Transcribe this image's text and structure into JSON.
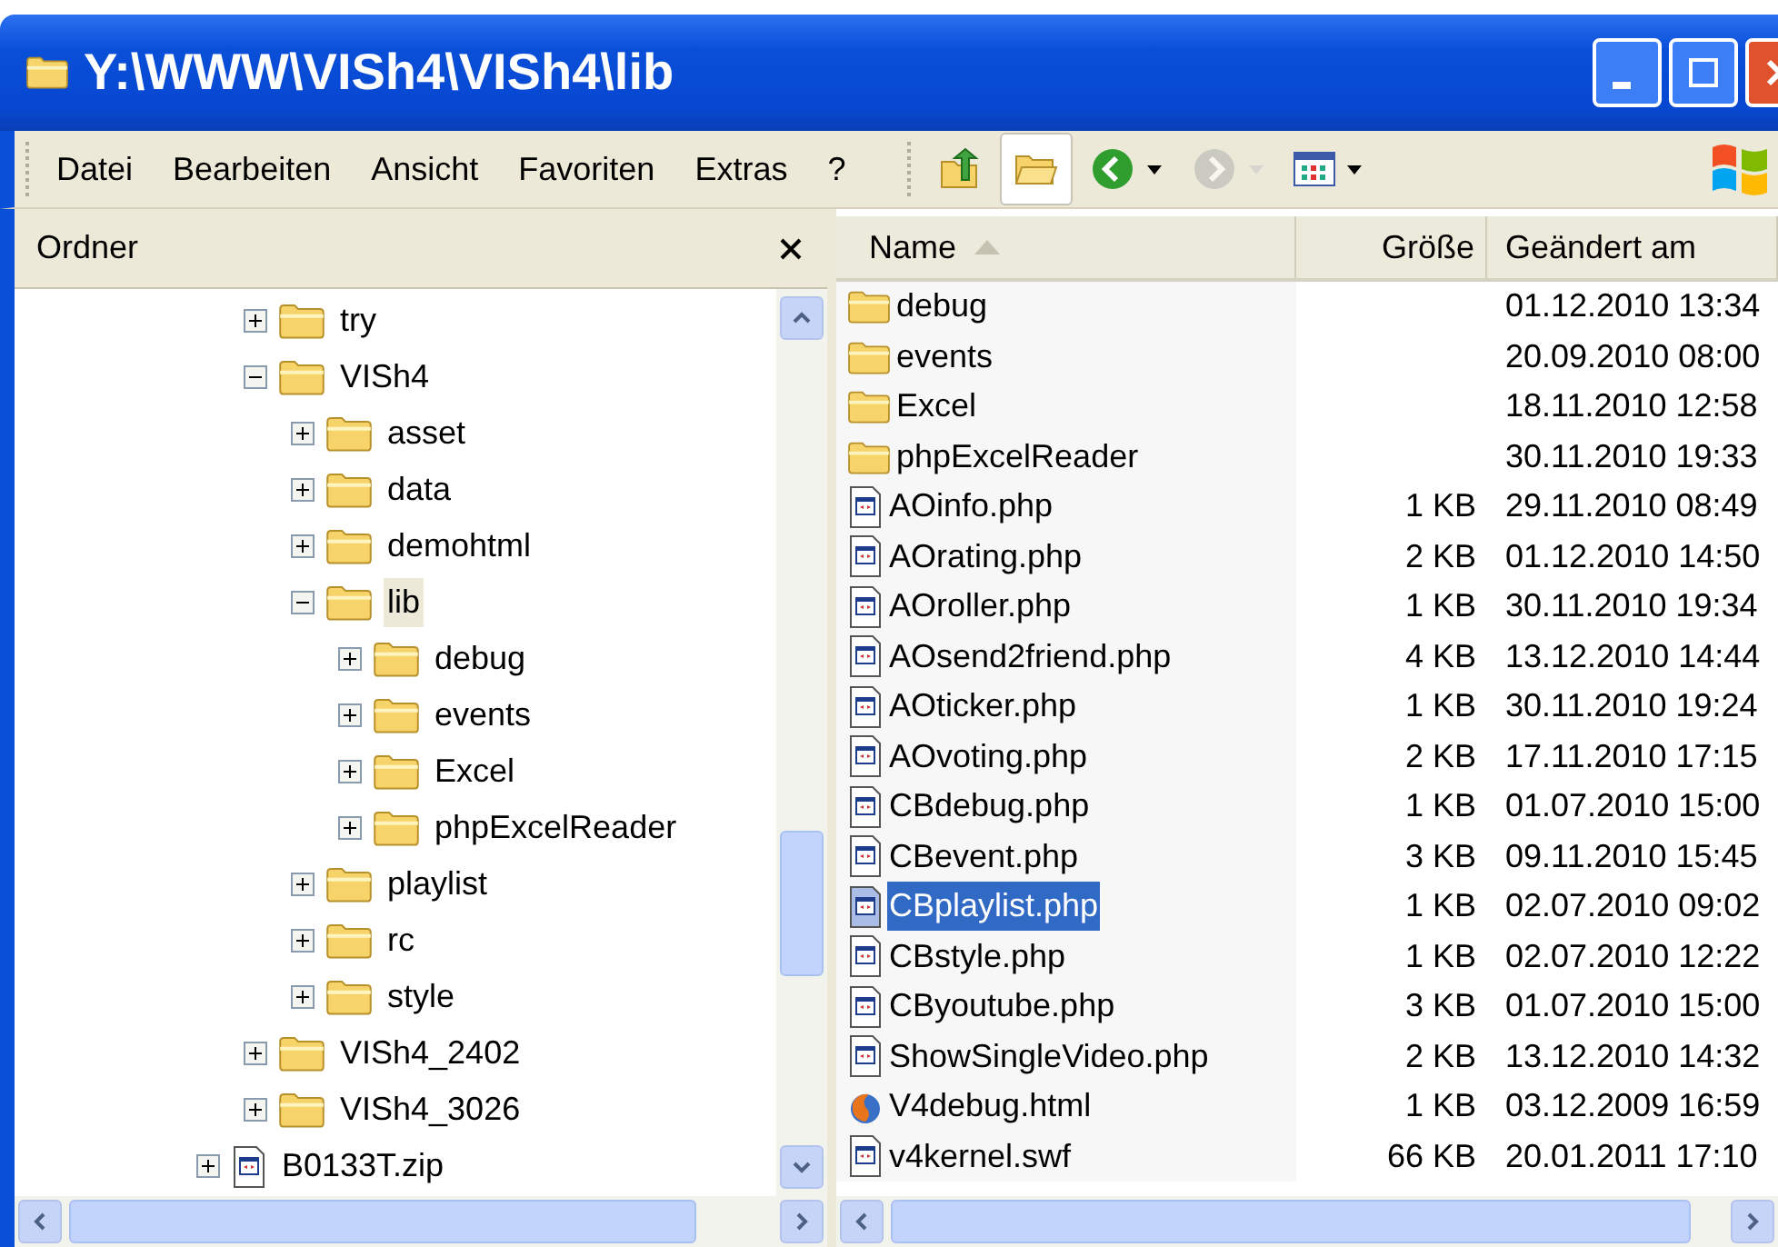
{
  "window": {
    "title": "Y:\\WWW\\VISh4\\VISh4\\lib"
  },
  "menu": [
    {
      "label": "Datei"
    },
    {
      "label": "Bearbeiten"
    },
    {
      "label": "Ansicht"
    },
    {
      "label": "Favoriten"
    },
    {
      "label": "Extras"
    },
    {
      "label": "?"
    }
  ],
  "toolbar": [
    {
      "kind": "up",
      "selected": false,
      "disabled": false
    },
    {
      "kind": "folders",
      "selected": true,
      "disabled": false
    },
    {
      "kind": "back",
      "selected": false,
      "disabled": false
    },
    {
      "kind": "forward",
      "selected": false,
      "disabled": true
    },
    {
      "kind": "views",
      "selected": false,
      "disabled": false
    }
  ],
  "folder_pane": {
    "title": "Ordner",
    "items": [
      {
        "children": [
          {
            "label": "try",
            "kind": "folder",
            "expanded": false,
            "selected": false
          },
          {
            "label": "VISh4",
            "kind": "folder",
            "expanded": true,
            "selected": false,
            "children": [
              {
                "label": "asset",
                "kind": "folder",
                "expanded": false,
                "selected": false
              },
              {
                "label": "data",
                "kind": "folder",
                "expanded": false,
                "selected": false
              },
              {
                "label": "demohtml",
                "kind": "folder",
                "expanded": false,
                "selected": false
              },
              {
                "label": "lib",
                "kind": "folder",
                "expanded": true,
                "selected": true,
                "children": [
                  {
                    "label": "debug",
                    "kind": "folder",
                    "expanded": false,
                    "selected": false
                  },
                  {
                    "label": "events",
                    "kind": "folder",
                    "expanded": false,
                    "selected": false
                  },
                  {
                    "label": "Excel",
                    "kind": "folder",
                    "expanded": false,
                    "selected": false
                  },
                  {
                    "label": "phpExcelReader",
                    "kind": "folder",
                    "expanded": false,
                    "selected": false
                  }
                ]
              },
              {
                "label": "playlist",
                "kind": "folder",
                "expanded": false,
                "selected": false
              },
              {
                "label": "rc",
                "kind": "folder",
                "expanded": false,
                "selected": false
              },
              {
                "label": "style",
                "kind": "folder",
                "expanded": false,
                "selected": false
              }
            ]
          },
          {
            "label": "VISh4_2402",
            "kind": "folder",
            "expanded": false,
            "selected": false
          },
          {
            "label": "VISh4_3026",
            "kind": "folder",
            "expanded": false,
            "selected": false
          }
        ]
      },
      {
        "label": "B0133T.zip",
        "kind": "file",
        "expanded": false,
        "selected": false
      }
    ]
  },
  "file_list": {
    "columns": [
      "Name",
      "Größe",
      "Geändert am"
    ],
    "rows": [
      {
        "name": "debug",
        "kind": "folder",
        "modified": "01.12.2010 13:34",
        "selected": false
      },
      {
        "name": "events",
        "kind": "folder",
        "modified": "20.09.2010 08:00",
        "selected": false
      },
      {
        "name": "Excel",
        "kind": "folder",
        "modified": "18.11.2010 12:58",
        "selected": false
      },
      {
        "name": "phpExcelReader",
        "kind": "folder",
        "modified": "30.11.2010 19:33",
        "selected": false
      },
      {
        "name": "AOinfo.php",
        "kind": "file",
        "size": "1 KB",
        "modified": "29.11.2010 08:49",
        "selected": false
      },
      {
        "name": "AOrating.php",
        "kind": "file",
        "size": "2 KB",
        "modified": "01.12.2010 14:50",
        "selected": false
      },
      {
        "name": "AOroller.php",
        "kind": "file",
        "size": "1 KB",
        "modified": "30.11.2010 19:34",
        "selected": false
      },
      {
        "name": "AOsend2friend.php",
        "kind": "file",
        "size": "4 KB",
        "modified": "13.12.2010 14:44",
        "selected": false
      },
      {
        "name": "AOticker.php",
        "kind": "file",
        "size": "1 KB",
        "modified": "30.11.2010 19:24",
        "selected": false
      },
      {
        "name": "AOvoting.php",
        "kind": "file",
        "size": "2 KB",
        "modified": "17.11.2010 17:15",
        "selected": false
      },
      {
        "name": "CBdebug.php",
        "kind": "file",
        "size": "1 KB",
        "modified": "01.07.2010 15:00",
        "selected": false
      },
      {
        "name": "CBevent.php",
        "kind": "file",
        "size": "3 KB",
        "modified": "09.11.2010 15:45",
        "selected": false
      },
      {
        "name": "CBplaylist.php",
        "kind": "file",
        "size": "1 KB",
        "modified": "02.07.2010 09:02",
        "selected": true
      },
      {
        "name": "CBstyle.php",
        "kind": "file",
        "size": "1 KB",
        "modified": "02.07.2010 12:22",
        "selected": false
      },
      {
        "name": "CByoutube.php",
        "kind": "file",
        "size": "3 KB",
        "modified": "01.07.2010 15:00",
        "selected": false
      },
      {
        "name": "ShowSingleVideo.php",
        "kind": "file",
        "size": "2 KB",
        "modified": "13.12.2010 14:32",
        "selected": false
      },
      {
        "name": "V4debug.html",
        "kind": "web",
        "size": "1 KB",
        "modified": "03.12.2009 16:59",
        "selected": false
      },
      {
        "name": "v4kernel.swf",
        "kind": "file",
        "size": "66 KB",
        "modified": "20.01.2011 17:10",
        "selected": false
      }
    ]
  }
}
